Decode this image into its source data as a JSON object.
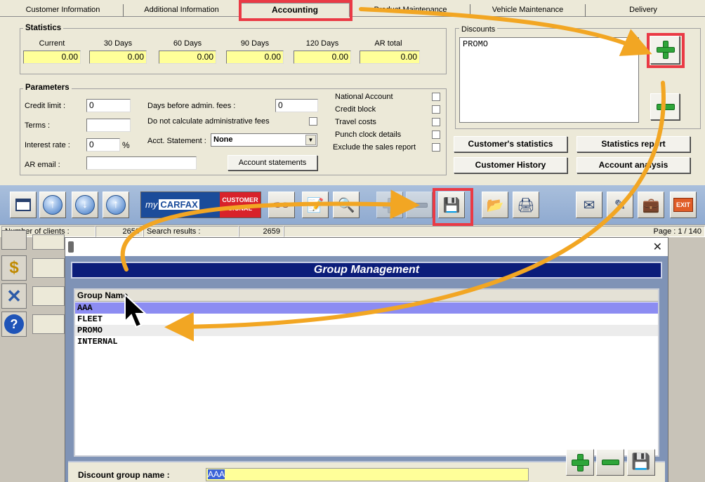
{
  "tabs": [
    {
      "label": "Customer Information",
      "active": false
    },
    {
      "label": "Additional Information",
      "active": false
    },
    {
      "label": "Accounting",
      "active": true
    },
    {
      "label": "Product Maintenance",
      "active": false
    },
    {
      "label": "Vehicle Maintenance",
      "active": false
    },
    {
      "label": "Delivery",
      "active": false
    }
  ],
  "statistics": {
    "title": "Statistics",
    "columns": [
      {
        "label": "Current",
        "value": "0.00"
      },
      {
        "label": "30 Days",
        "value": "0.00"
      },
      {
        "label": "60 Days",
        "value": "0.00"
      },
      {
        "label": "90 Days",
        "value": "0.00"
      },
      {
        "label": "120 Days",
        "value": "0.00"
      },
      {
        "label": "AR total",
        "value": "0.00"
      }
    ]
  },
  "parameters": {
    "title": "Parameters",
    "credit_limit_label": "Credit limit :",
    "credit_limit_value": "0",
    "terms_label": "Terms :",
    "terms_value": "",
    "interest_rate_label": "Interest rate :",
    "interest_rate_value": "0",
    "interest_rate_unit": "%",
    "ar_email_label": "AR email :",
    "ar_email_value": "",
    "days_before_fees_label": "Days before admin. fees :",
    "days_before_fees_value": "0",
    "no_admin_fees_label": "Do not calculate administrative fees",
    "acct_statement_label": "Acct. Statement :",
    "acct_statement_value": "None",
    "account_statements_button": "Account statements",
    "checkboxes": [
      {
        "label": "National Account"
      },
      {
        "label": "Credit block"
      },
      {
        "label": "Travel costs"
      },
      {
        "label": "Punch clock details"
      },
      {
        "label": "Exclude the sales report"
      }
    ]
  },
  "discounts": {
    "title": "Discounts",
    "items": [
      "PROMO"
    ]
  },
  "report_buttons": {
    "customers_statistics": "Customer's statistics",
    "statistics_report": "Statistics report",
    "customer_history": "Customer History",
    "account_analysis": "Account analysis"
  },
  "carfax": {
    "brand_prefix": "my",
    "brand_name": "CARFAX",
    "badge": "CUSTOMER SIGNAL"
  },
  "toolbar": {
    "exit_label": "EXIT"
  },
  "status_bar": {
    "clients_label": "Number of clients :",
    "clients_value": "2659",
    "search_label": "Search results :",
    "search_value": "2659",
    "page_label": "Page : 1 / 140"
  },
  "sidebar": {
    "dollar_glyph": "$",
    "help_glyph": "?"
  },
  "dialog": {
    "close_glyph": "✕",
    "title": "Group Management",
    "grid_header": "Group Name",
    "rows": [
      {
        "name": "AAA",
        "selected": true
      },
      {
        "name": "FLEET",
        "selected": false
      },
      {
        "name": "PROMO",
        "selected": false
      },
      {
        "name": "INTERNAL",
        "selected": false
      }
    ],
    "discount_group_label": "Discount group name :",
    "discount_group_value": "AAA"
  },
  "colors": {
    "annotation_red": "#ea3a45",
    "annotation_arrow": "#f2a623",
    "field_yellow": "#ffff99",
    "selection_blue": "#8c8cf2",
    "header_navy": "#0b1d7a"
  }
}
